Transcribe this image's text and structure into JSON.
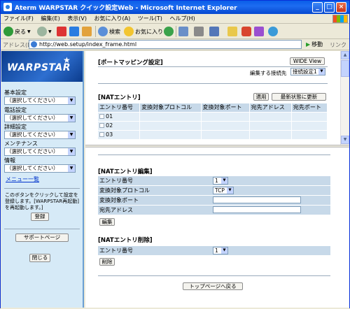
{
  "window": {
    "title": "Aterm WARPSTAR クイック設定Web - Microsoft Internet Explorer",
    "controls": {
      "minimize": "_",
      "maximize": "□",
      "close": "×"
    }
  },
  "menubar": [
    "ファイル(F)",
    "編集(E)",
    "表示(V)",
    "お気に入り(A)",
    "ツール(T)",
    "ヘルプ(H)"
  ],
  "toolbar": {
    "back": "戻る",
    "search": "検索",
    "favorites": "お気に入り"
  },
  "address": {
    "label": "アドレス(D)",
    "url": "http://web.setup/index_frame.html",
    "go": "移動",
    "links": "リンク"
  },
  "sidebar": {
    "logo": "WARPSTAR",
    "sections": [
      {
        "label": "基本設定",
        "select": "（選択してください）"
      },
      {
        "label": "電話設定",
        "select": "（選択してください）"
      },
      {
        "label": "詳細設定",
        "select": "（選択してください）"
      },
      {
        "label": "メンテナンス",
        "select": "（選択してください）"
      },
      {
        "label": "情報",
        "select": "（選択してください）"
      }
    ],
    "menu_list": "メニュー一覧",
    "notice": "このボタンをクリックして設定を登録します。[WARPSTAR再起動]を再起動します。]",
    "register": "登録",
    "support": "サポートページ",
    "close": "閉じる"
  },
  "top_frame": {
    "title": "[ポートマッピング設定]",
    "wide_view": "WIDE View",
    "connection_label": "編集する接続先",
    "connection_value": "接続設定1",
    "nat_title": "[NATエントリ]",
    "apply": "適用",
    "refresh": "最新状態に更新",
    "columns": [
      "エントリ番号",
      "変換対象プロトコル",
      "変換対象ポート",
      "宛先アドレス",
      "宛先ポート"
    ],
    "rows": [
      "01",
      "02",
      "03"
    ]
  },
  "bottom_frame": {
    "edit_title": "[NATエントリ編集]",
    "entry_label": "エントリ番号",
    "entry_value": "1",
    "protocol_label": "変換対象プロトコル",
    "protocol_value": "TCP",
    "port_label": "変換対象ポート",
    "dest_label": "宛先アドレス",
    "edit_button": "編集",
    "delete_title": "[NATエントリ削除]",
    "delete_entry_label": "エントリ番号",
    "delete_entry_value": "1",
    "delete_button": "削除",
    "top_page": "トップページへ戻る"
  }
}
